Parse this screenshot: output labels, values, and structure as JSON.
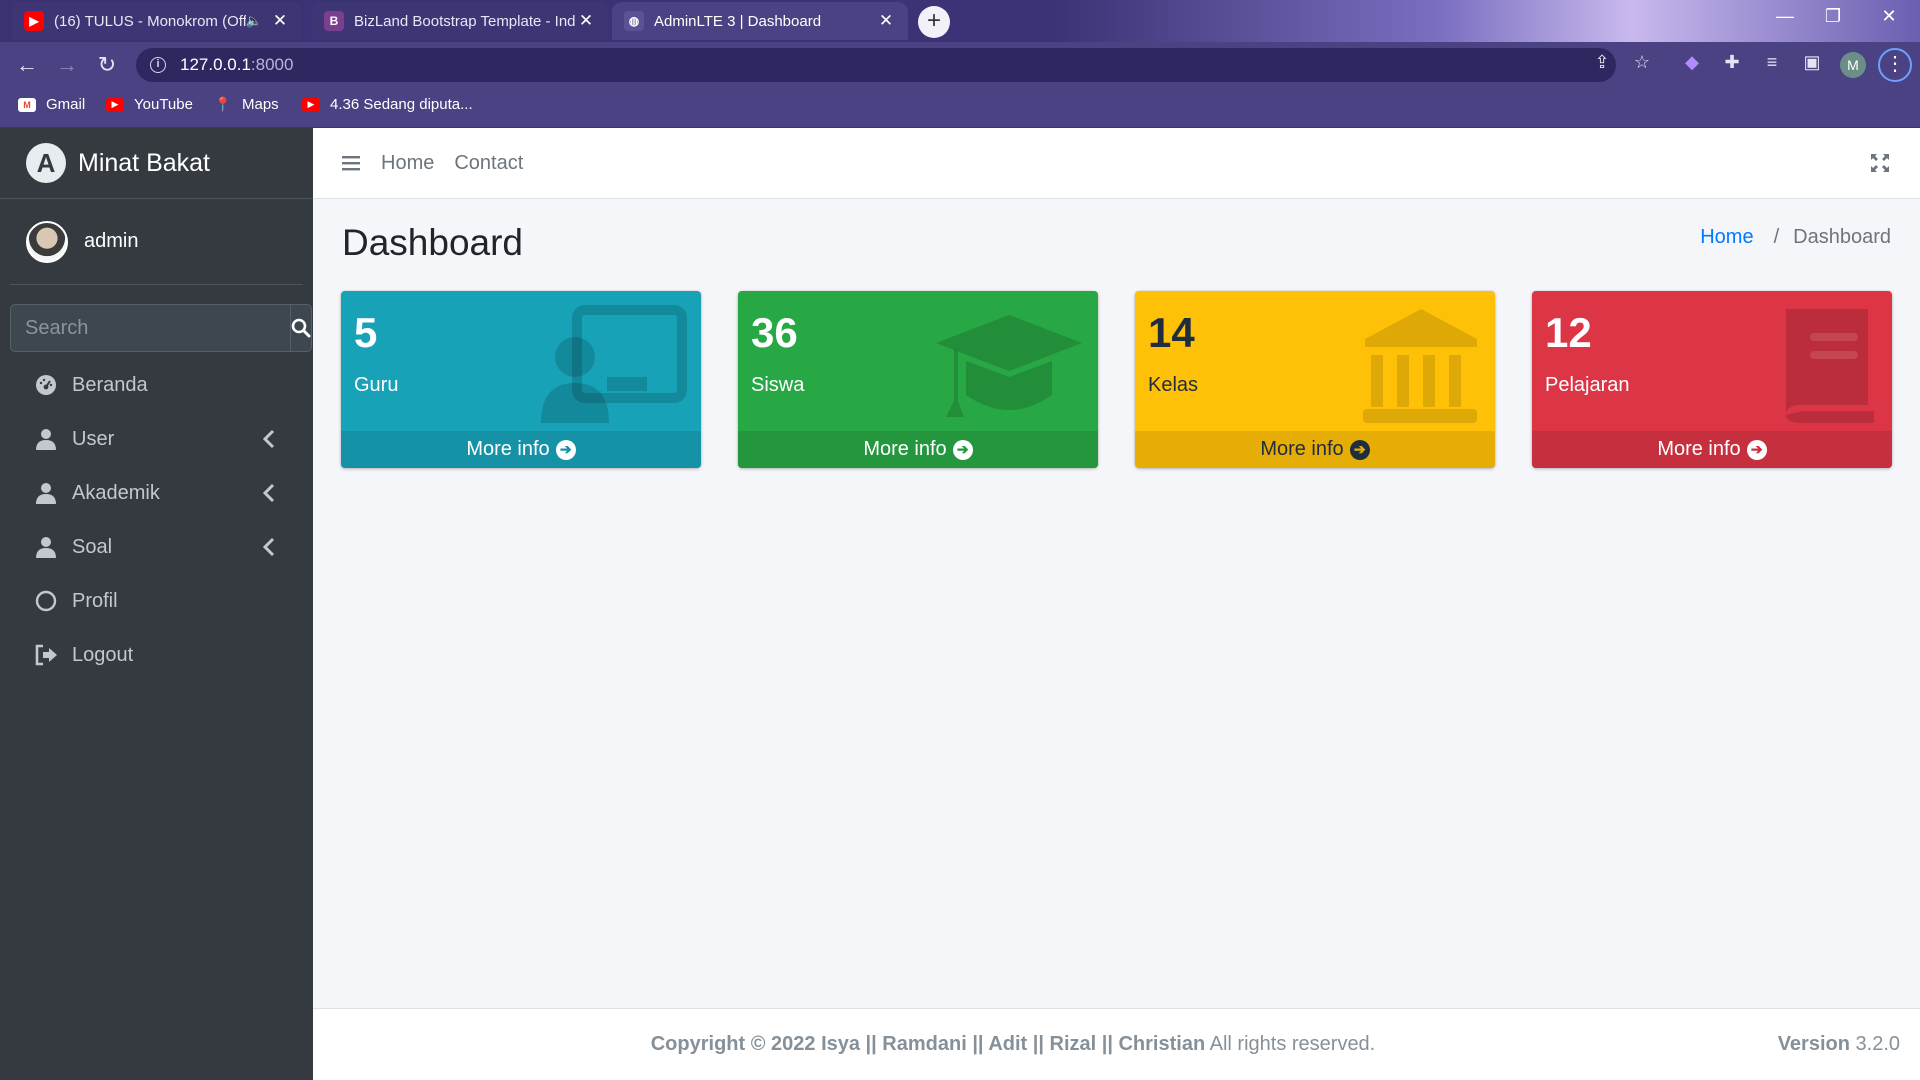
{
  "browser": {
    "tabs": [
      {
        "title": "(16) TULUS - Monokrom (Off",
        "favicon": "youtube-icon",
        "audio": true,
        "active": false
      },
      {
        "title": "BizLand Bootstrap Template - Ind",
        "favicon": "bootstrap-icon",
        "active": false
      },
      {
        "title": "AdminLTE 3 | Dashboard",
        "favicon": "globe-icon",
        "active": true
      }
    ],
    "url_host": "127.0.0.1",
    "url_port": ":8000",
    "profile_initial": "M",
    "bookmarks": [
      {
        "label": "Gmail",
        "icon": "gmail-icon"
      },
      {
        "label": "YouTube",
        "icon": "youtube-icon"
      },
      {
        "label": "Maps",
        "icon": "maps-icon"
      },
      {
        "label": "4.36 Sedang diputa...",
        "icon": "youtube-icon"
      }
    ]
  },
  "sidebar": {
    "brand": "Minat Bakat",
    "user": "admin",
    "search_placeholder": "Search",
    "items": [
      {
        "label": "Beranda",
        "icon": "tachometer-icon",
        "has_children": false
      },
      {
        "label": "User",
        "icon": "user-icon",
        "has_children": true
      },
      {
        "label": "Akademik",
        "icon": "user-icon",
        "has_children": true
      },
      {
        "label": "Soal",
        "icon": "user-icon",
        "has_children": true
      },
      {
        "label": "Profil",
        "icon": "circle-icon",
        "has_children": false
      },
      {
        "label": "Logout",
        "icon": "sign-out-icon",
        "has_children": false
      }
    ]
  },
  "topnav": {
    "links": [
      "Home",
      "Contact"
    ]
  },
  "content": {
    "title": "Dashboard",
    "breadcrumb": {
      "home": "Home",
      "separator": "/",
      "current": "Dashboard"
    }
  },
  "cards": [
    {
      "value": "5",
      "label": "Guru",
      "more": "More info",
      "color": "#17a2b8",
      "icon": "chalkboard-teacher-icon"
    },
    {
      "value": "36",
      "label": "Siswa",
      "more": "More info",
      "color": "#28a745",
      "icon": "graduation-cap-icon"
    },
    {
      "value": "14",
      "label": "Kelas",
      "more": "More info",
      "color": "#ffc107",
      "icon": "university-icon"
    },
    {
      "value": "12",
      "label": "Pelajaran",
      "more": "More info",
      "color": "#dc3545",
      "icon": "book-icon"
    }
  ],
  "footer": {
    "copyright": "Copyright © 2022 Isya || Ramdani || Adit || Rizal || Christian",
    "rights": "All rights reserved.",
    "version_label": "Version",
    "version": "3.2.0"
  }
}
